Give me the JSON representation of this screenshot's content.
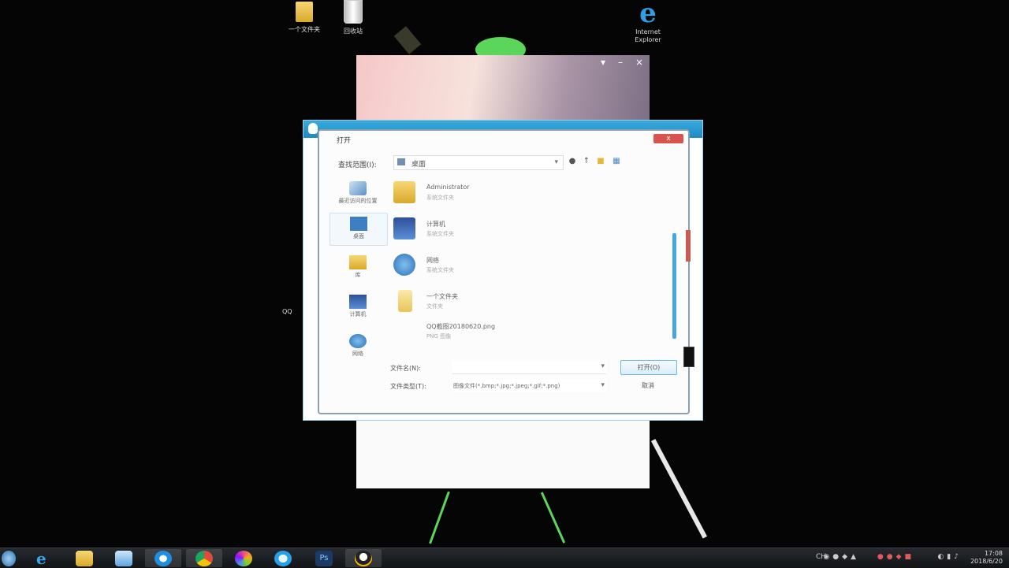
{
  "desktop": {
    "icons": [
      {
        "label": "一个文件夹"
      },
      {
        "label": "回收站"
      },
      {
        "label": "Internet Explorer"
      }
    ],
    "side_text": "QQ"
  },
  "dialog": {
    "title": "打开",
    "close_label": "x",
    "look_in_label": "查找范围(I):",
    "look_in_value": "桌面",
    "places": [
      {
        "label": "最近访问的位置"
      },
      {
        "label": "桌面"
      },
      {
        "label": "库"
      },
      {
        "label": "计算机"
      },
      {
        "label": "网络"
      }
    ],
    "files": [
      {
        "name": "Administrator",
        "sub": "系统文件夹"
      },
      {
        "name": "计算机",
        "sub": "系统文件夹"
      },
      {
        "name": "网络",
        "sub": "系统文件夹"
      },
      {
        "name": "一个文件夹",
        "sub": "文件夹"
      },
      {
        "name": "QQ截图20180620.png",
        "sub": "PNG 图像"
      }
    ],
    "file_name_label": "文件名(N):",
    "file_name_value": "",
    "file_type_label": "文件类型(T):",
    "file_type_value": "图像文件(*.bmp;*.jpg;*.jpeg;*.gif;*.png)",
    "open_button": "打开(O)",
    "cancel_button": "取消"
  },
  "taskbar": {
    "items": [
      "start",
      "ie",
      "explorer",
      "app",
      "qq-browser",
      "chrome",
      "color-app",
      "qq-browser-2",
      "photoshop",
      "qq"
    ],
    "clock_time": "17:08",
    "clock_date": "2018/6/20",
    "tray_lang": "CH"
  },
  "colors": {
    "titlebar": "#1d8bc3",
    "scroll_thumb": "#45a6e6",
    "close": "#d9534f"
  }
}
